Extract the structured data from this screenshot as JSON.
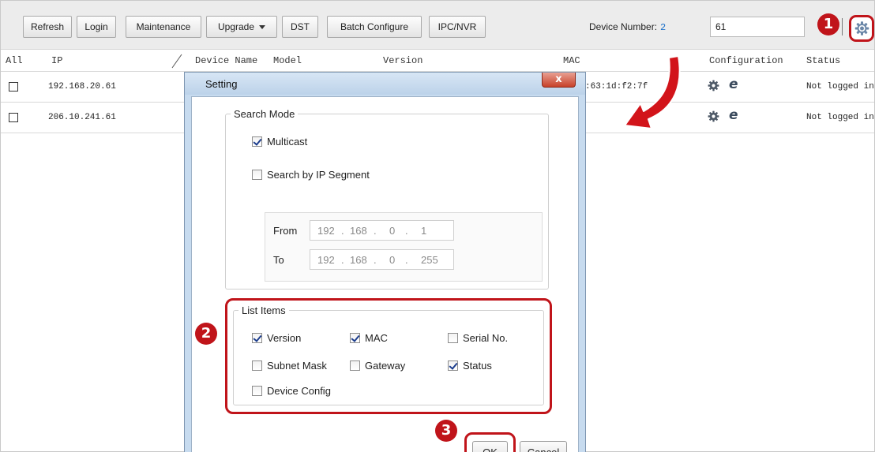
{
  "toolbar": {
    "refresh": "Refresh",
    "login": "Login",
    "maintenance": "Maintenance",
    "upgrade": "Upgrade",
    "dst": "DST",
    "batch_configure": "Batch Configure",
    "ipc_nvr": "IPC/NVR",
    "device_number_label": "Device Number:",
    "device_number_value": "2",
    "search_value": "61"
  },
  "table": {
    "headers": {
      "all": "All",
      "ip": "IP",
      "device_name": "Device Name",
      "model": "Model",
      "version": "Version",
      "mac": "MAC",
      "configuration": "Configuration",
      "status": "Status"
    },
    "rows": [
      {
        "ip": "192.168.20.61",
        "mac": ":63:1d:f2:7f",
        "config_icon": "e",
        "status": "Not logged in"
      },
      {
        "ip": "206.10.241.61",
        "mac": "",
        "config_icon": "e",
        "status": "Not logged in"
      }
    ]
  },
  "dialog": {
    "title": "Setting",
    "close": "x",
    "search_mode": {
      "legend": "Search Mode",
      "multicast": {
        "label": "Multicast",
        "checked": true
      },
      "by_ip_segment": {
        "label": "Search by IP Segment",
        "checked": false
      },
      "from_label": "From",
      "to_label": "To",
      "from_ip": [
        "192",
        "168",
        "0",
        "1"
      ],
      "to_ip": [
        "192",
        "168",
        "0",
        "255"
      ]
    },
    "list_items": {
      "legend": "List Items",
      "version": {
        "label": "Version",
        "checked": true
      },
      "mac": {
        "label": "MAC",
        "checked": true
      },
      "serial": {
        "label": "Serial No.",
        "checked": false
      },
      "subnet": {
        "label": "Subnet Mask",
        "checked": false
      },
      "gateway": {
        "label": "Gateway",
        "checked": false
      },
      "status": {
        "label": "Status",
        "checked": true
      },
      "device_config": {
        "label": "Device Config",
        "checked": false
      }
    },
    "ok": "OK",
    "cancel": "Cancel"
  },
  "callouts": [
    "1",
    "2",
    "3"
  ],
  "colors": {
    "highlight": "#c0141a",
    "accent_blue": "#1a6fc9"
  }
}
